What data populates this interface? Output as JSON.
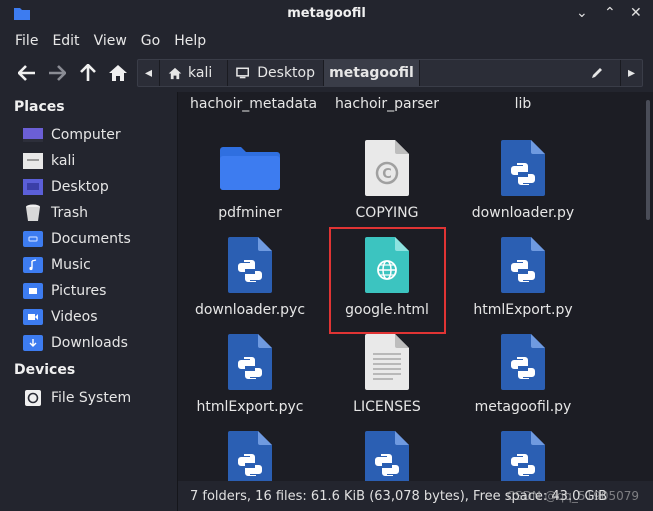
{
  "window": {
    "title": "metagoofil",
    "minimize_glyph": "⌄",
    "maximize_glyph": "⌃",
    "close_glyph": "✕"
  },
  "menu": [
    "File",
    "Edit",
    "View",
    "Go",
    "Help"
  ],
  "path": {
    "crumbs": [
      {
        "label": "kali",
        "icon": "home-icon"
      },
      {
        "label": "Desktop",
        "icon": "desktop-icon"
      },
      {
        "label": "metagoofil",
        "icon": ""
      }
    ],
    "left_arrow": "◂",
    "right_arrow": "▸"
  },
  "sidebar": {
    "places_heading": "Places",
    "places": [
      {
        "label": "Computer",
        "icon": "computer-icon"
      },
      {
        "label": "kali",
        "icon": "home-folder-icon"
      },
      {
        "label": "Desktop",
        "icon": "desktop-folder-icon"
      },
      {
        "label": "Trash",
        "icon": "trash-icon"
      },
      {
        "label": "Documents",
        "icon": "documents-folder-icon"
      },
      {
        "label": "Music",
        "icon": "music-folder-icon"
      },
      {
        "label": "Pictures",
        "icon": "pictures-folder-icon"
      },
      {
        "label": "Videos",
        "icon": "videos-folder-icon"
      },
      {
        "label": "Downloads",
        "icon": "downloads-folder-icon"
      }
    ],
    "devices_heading": "Devices",
    "devices": [
      {
        "label": "File System",
        "icon": "drive-icon"
      }
    ]
  },
  "files": {
    "row0": [
      "hachoir_metadata",
      "hachoir_parser",
      "lib"
    ],
    "items": [
      {
        "name": "pdfminer",
        "type": "folder"
      },
      {
        "name": "COPYING",
        "type": "copyright"
      },
      {
        "name": "downloader.py",
        "type": "python"
      },
      {
        "name": "downloader.pyc",
        "type": "python"
      },
      {
        "name": "google.html",
        "type": "html",
        "highlighted": true
      },
      {
        "name": "htmlExport.py",
        "type": "python"
      },
      {
        "name": "htmlExport.pyc",
        "type": "python"
      },
      {
        "name": "LICENSES",
        "type": "text"
      },
      {
        "name": "metagoofil.py",
        "type": "python"
      },
      {
        "name": "",
        "type": "python"
      },
      {
        "name": "",
        "type": "python"
      },
      {
        "name": "",
        "type": "python"
      }
    ]
  },
  "status": "7 folders, 16 files: 61.6 KiB (63,078 bytes), Free space: 43.0 GiB",
  "watermark": "CSDN @qq_51905079",
  "colors": {
    "accent_blue": "#3d7cf0",
    "python_blue": "#2b5fb3",
    "html_teal": "#3cc4c0",
    "highlight_red": "#e03434"
  }
}
